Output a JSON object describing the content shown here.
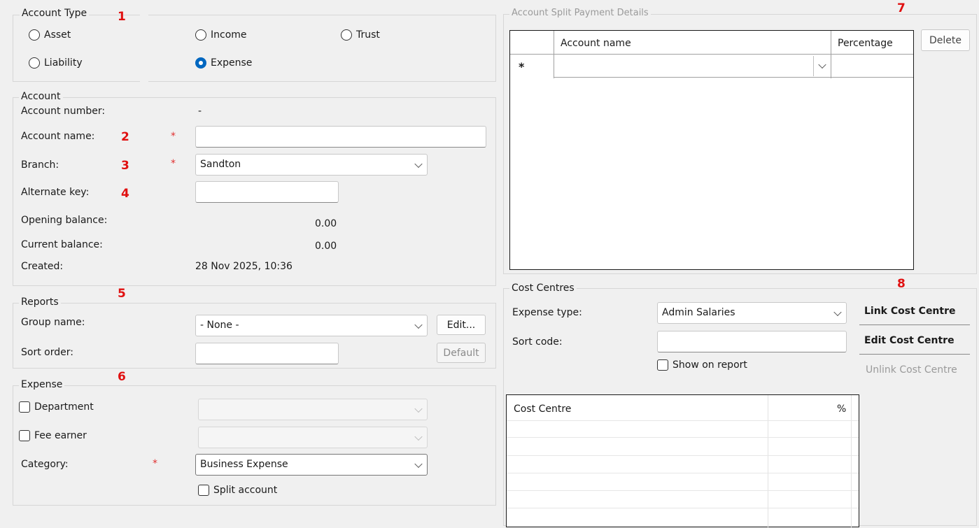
{
  "annotations": [
    "1",
    "2",
    "3",
    "4",
    "5",
    "6",
    "7",
    "8"
  ],
  "account_type": {
    "legend": "Account Type",
    "options": [
      {
        "label": "Asset",
        "selected": false
      },
      {
        "label": "Income",
        "selected": false
      },
      {
        "label": "Trust",
        "selected": false
      },
      {
        "label": "Liability",
        "selected": false
      },
      {
        "label": "Expense",
        "selected": true
      }
    ]
  },
  "account": {
    "legend": "Account",
    "account_number_label": "Account number:",
    "account_number_value": "-",
    "account_name_label": "Account name:",
    "account_name_value": "",
    "branch_label": "Branch:",
    "branch_value": "Sandton",
    "alternate_key_label": "Alternate key:",
    "alternate_key_value": "",
    "opening_balance_label": "Opening balance:",
    "opening_balance_value": "0.00",
    "current_balance_label": "Current balance:",
    "current_balance_value": "0.00",
    "created_label": "Created:",
    "created_value": "28 Nov 2025, 10:36",
    "required_mark": "*"
  },
  "reports": {
    "legend": "Reports",
    "group_name_label": "Group name:",
    "group_name_value": "- None -",
    "edit_button": "Edit...",
    "sort_order_label": "Sort order:",
    "sort_order_value": "",
    "default_button": "Default"
  },
  "expense": {
    "legend": "Expense",
    "department_label": "Department",
    "fee_earner_label": "Fee earner",
    "category_label": "Category:",
    "category_value": "Business Expense",
    "split_account_label": "Split account"
  },
  "split_payment": {
    "legend": "Account Split Payment Details",
    "columns": [
      "Account name",
      "Percentage"
    ],
    "new_row_marker": "*",
    "delete_button": "Delete"
  },
  "cost_centres": {
    "legend": "Cost Centres",
    "expense_type_label": "Expense type:",
    "expense_type_value": "Admin Salaries",
    "sort_code_label": "Sort code:",
    "sort_code_value": "",
    "show_on_report_label": "Show on report",
    "link_button": "Link Cost Centre",
    "edit_button": "Edit Cost Centre",
    "unlink_button": "Unlink Cost Centre",
    "columns": [
      "Cost Centre",
      "%"
    ]
  },
  "colors": {
    "background": "#f0f0f0",
    "accent": "#0067c0",
    "annotation": "#e01010",
    "required": "#e03030"
  }
}
